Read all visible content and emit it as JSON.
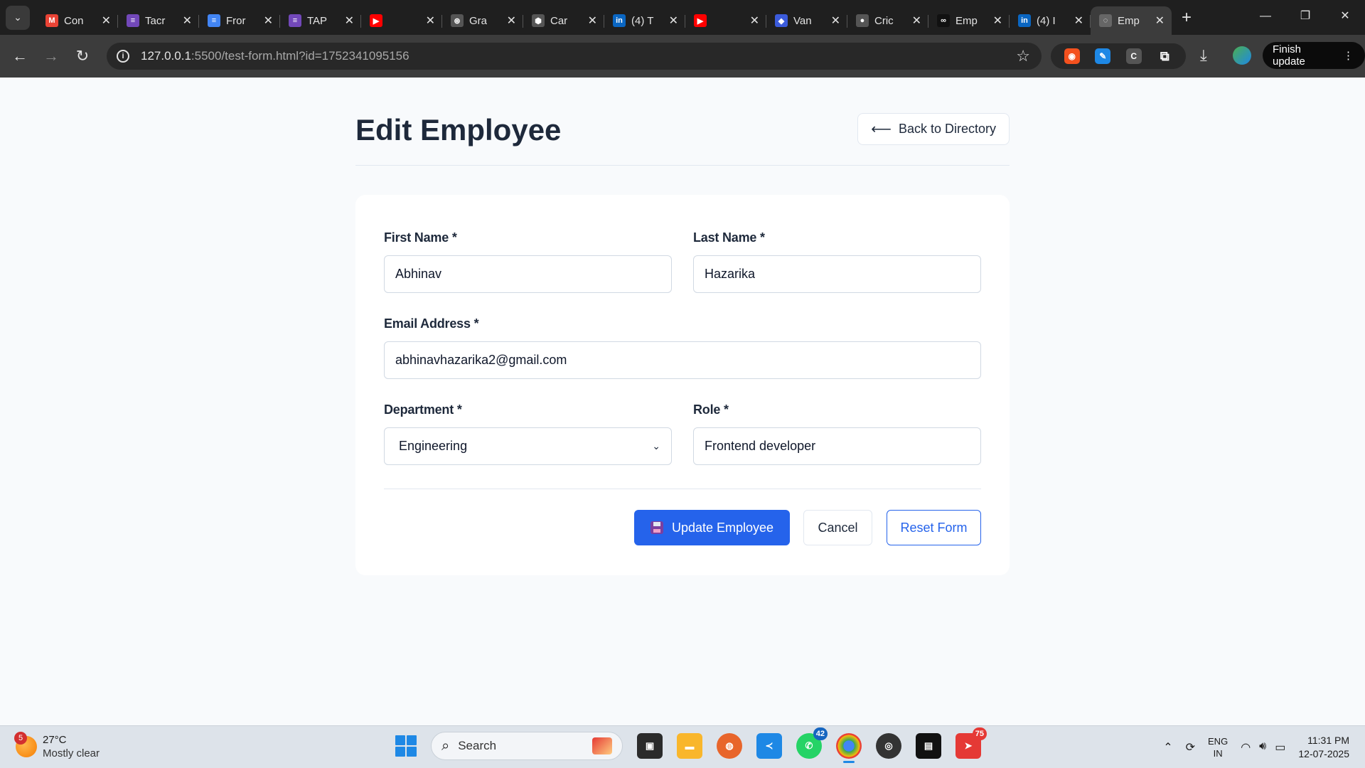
{
  "browser": {
    "tabs": [
      {
        "title": "Con",
        "icon": "gmail-icon",
        "color": "#ea4335",
        "glyph": "M"
      },
      {
        "title": "Tacr",
        "icon": "forms-icon",
        "color": "#7248b9",
        "glyph": "≡"
      },
      {
        "title": "Fror",
        "icon": "docs-icon",
        "color": "#4285f4",
        "glyph": "≡"
      },
      {
        "title": "TAP",
        "icon": "forms-icon",
        "color": "#7248b9",
        "glyph": "≡"
      },
      {
        "title": "",
        "icon": "youtube-icon",
        "color": "#ff0000",
        "glyph": "▶"
      },
      {
        "title": "Gra",
        "icon": "openai-icon",
        "color": "#555555",
        "glyph": "⊛"
      },
      {
        "title": "Car",
        "icon": "shield-icon",
        "color": "#555555",
        "glyph": "⬢"
      },
      {
        "title": "(4) T",
        "icon": "linkedin-icon",
        "color": "#0a66c2",
        "glyph": "in"
      },
      {
        "title": "",
        "icon": "youtube-icon",
        "color": "#ff0000",
        "glyph": "▶"
      },
      {
        "title": "Van",
        "icon": "app-icon",
        "color": "#3b5bdb",
        "glyph": "◆"
      },
      {
        "title": "Cric",
        "icon": "github-icon",
        "color": "#555555",
        "glyph": "●"
      },
      {
        "title": "Emp",
        "icon": "app-icon",
        "color": "#111111",
        "glyph": "∞"
      },
      {
        "title": "(4) I",
        "icon": "linkedin-icon",
        "color": "#0a66c2",
        "glyph": "in"
      },
      {
        "title": "Emp",
        "icon": "globe-icon",
        "color": "#666666",
        "glyph": "◌",
        "active": true
      }
    ],
    "url_host": "127.0.0.1",
    "url_rest": ":5500/test-form.html?id=1752341095156",
    "finish_update": "Finish update"
  },
  "page": {
    "title": "Edit Employee",
    "back_button": "Back to Directory",
    "form": {
      "first_name_label": "First Name *",
      "first_name_value": "Abhinav",
      "last_name_label": "Last Name *",
      "last_name_value": "Hazarika",
      "email_label": "Email Address *",
      "email_value": "abhinavhazarika2@gmail.com",
      "department_label": "Department *",
      "department_value": "Engineering",
      "role_label": "Role *",
      "role_value": "Frontend developer"
    },
    "buttons": {
      "update": "Update Employee",
      "cancel": "Cancel",
      "reset": "Reset Form"
    }
  },
  "taskbar": {
    "weather_badge": "5",
    "temperature": "27°C",
    "condition": "Mostly clear",
    "search_placeholder": "Search",
    "whatsapp_badge": "42",
    "telegram_badge": "75",
    "lang_top": "ENG",
    "lang_bottom": "IN",
    "time": "11:31 PM",
    "date": "12-07-2025"
  }
}
